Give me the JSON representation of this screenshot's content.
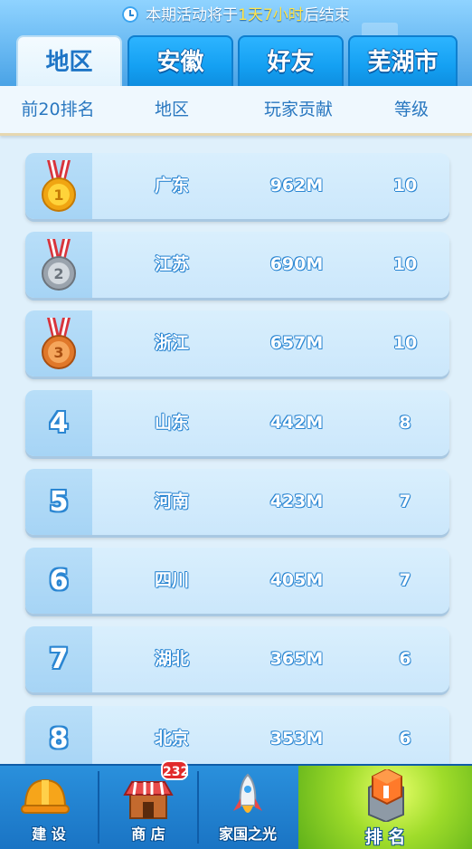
{
  "notice": {
    "prefix": "本期活动将于",
    "highlight": "1天7小时",
    "suffix": "后结束"
  },
  "tabs": [
    {
      "label": "地区",
      "active": true
    },
    {
      "label": "安徽",
      "active": false
    },
    {
      "label": "好友",
      "active": false
    },
    {
      "label": "芜湖市",
      "active": false
    }
  ],
  "columns": {
    "rank": "前20排名",
    "region": "地区",
    "contribution": "玩家贡献",
    "level": "等级"
  },
  "rows": [
    {
      "rank": "1",
      "medal": "gold-medal-icon",
      "region": "广东",
      "contribution": "962M",
      "level": "10"
    },
    {
      "rank": "2",
      "medal": "silver-medal-icon",
      "region": "江苏",
      "contribution": "690M",
      "level": "10"
    },
    {
      "rank": "3",
      "medal": "bronze-medal-icon",
      "region": "浙江",
      "contribution": "657M",
      "level": "10"
    },
    {
      "rank": "4",
      "region": "山东",
      "contribution": "442M",
      "level": "8"
    },
    {
      "rank": "5",
      "region": "河南",
      "contribution": "423M",
      "level": "7"
    },
    {
      "rank": "6",
      "region": "四川",
      "contribution": "405M",
      "level": "7"
    },
    {
      "rank": "7",
      "region": "湖北",
      "contribution": "365M",
      "level": "6"
    },
    {
      "rank": "8",
      "region": "北京",
      "contribution": "353M",
      "level": "6"
    }
  ],
  "nav": {
    "build": {
      "label": "建 设",
      "icon": "hard-hat-icon"
    },
    "shop": {
      "label": "商 店",
      "icon": "shop-icon",
      "badge": "232"
    },
    "glory": {
      "label": "家国之光",
      "icon": "rocket-icon"
    },
    "rank": {
      "label": "排 名",
      "icon": "ranking-building-icon"
    }
  },
  "colors": {
    "accent": "#1e75c6",
    "tab": "#14a0f2",
    "badge": "#e12b2b",
    "active_nav": "#9fdc2a"
  }
}
